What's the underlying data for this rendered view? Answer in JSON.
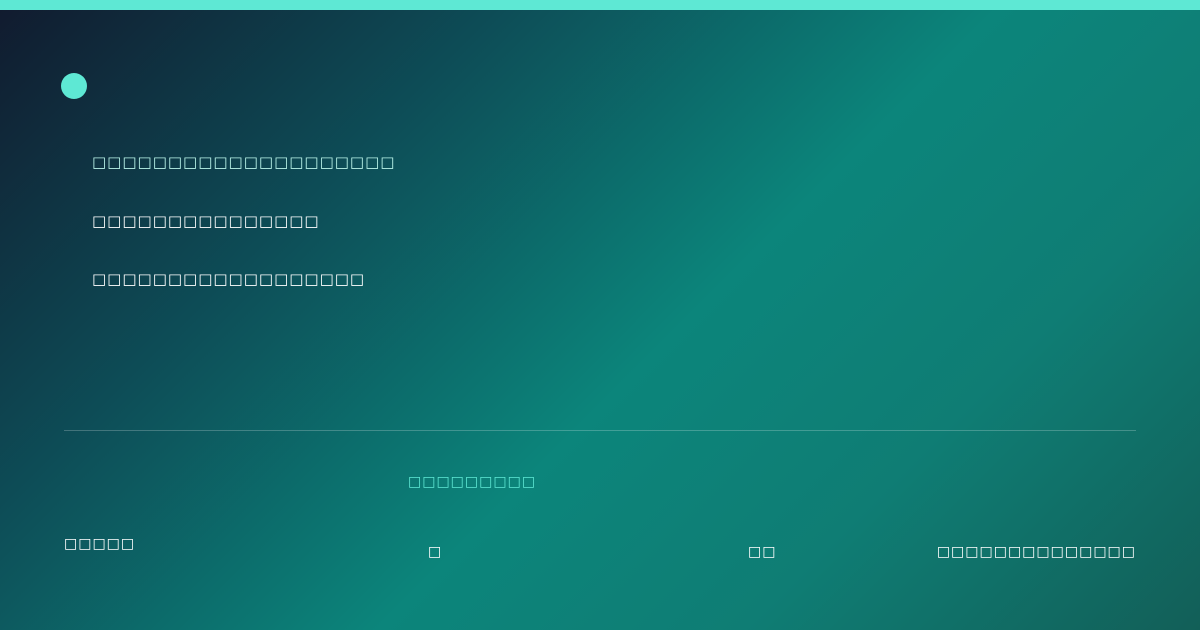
{
  "colors": {
    "accent": "#5ee8d4",
    "background_start": "#111a2e",
    "background_mid": "#0c857b",
    "background_end": "#125f58",
    "text": "#ffffff"
  },
  "header": {
    "brand_icon": "dot-icon"
  },
  "main": {
    "lines": [
      "□□□□□□□□□□□□□□□□□□□□",
      "□□□□□□□□□□□□□□□",
      "□□□□□□□□□□□□□□□□□□"
    ]
  },
  "footer": {
    "caption": "□□□□□□□□□",
    "left_text": "□□□□□",
    "item_a": "□",
    "item_b": "□□",
    "right_text": "□□□□□□□□□□□□□□"
  }
}
